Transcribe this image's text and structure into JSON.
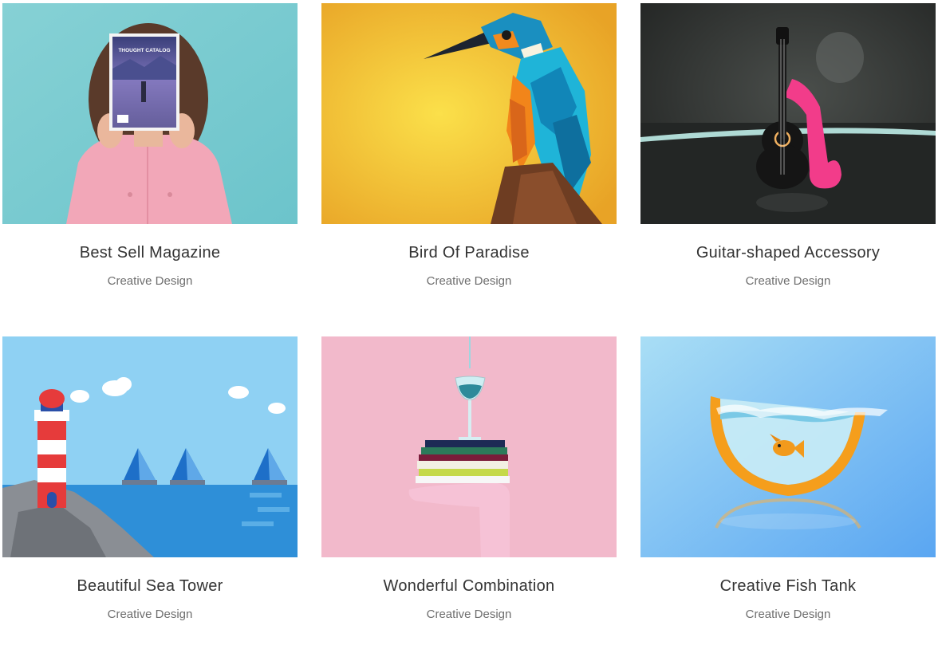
{
  "portfolio": {
    "items": [
      {
        "title": "Best Sell Magazine",
        "category": "Creative Design",
        "magazine_title": "THOUGHT CATALOG",
        "colors": {
          "bg": "#7ccdd2"
        }
      },
      {
        "title": "Bird Of Paradise",
        "category": "Creative Design",
        "colors": {
          "bg": "#f5c23a"
        }
      },
      {
        "title": "Guitar-shaped Accessory",
        "category": "Creative Design",
        "colors": {
          "bg": "#2c2f2d"
        }
      },
      {
        "title": "Beautiful Sea Tower",
        "category": "Creative Design",
        "colors": {
          "bg": "#8fd1f3"
        }
      },
      {
        "title": "Wonderful Combination",
        "category": "Creative Design",
        "colors": {
          "bg": "#f2b9cb"
        }
      },
      {
        "title": "Creative Fish Tank",
        "category": "Creative Design",
        "colors": {
          "bg": "#7ab8f2"
        }
      }
    ]
  }
}
